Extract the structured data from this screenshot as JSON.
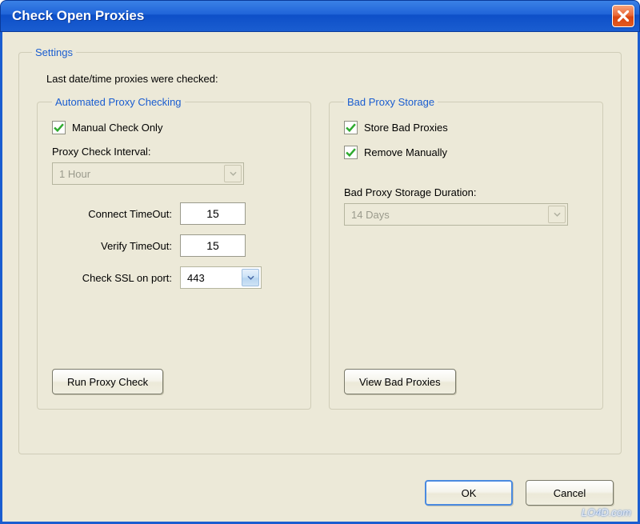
{
  "window": {
    "title": "Check Open Proxies"
  },
  "settings": {
    "legend": "Settings",
    "last_checked_label": "Last date/time proxies were checked:"
  },
  "auto": {
    "legend": "Automated Proxy Checking",
    "manual_check_only": "Manual Check Only",
    "interval_label": "Proxy Check Interval:",
    "interval_value": "1 Hour",
    "connect_timeout_label": "Connect TimeOut:",
    "connect_timeout_value": "15",
    "verify_timeout_label": "Verify TimeOut:",
    "verify_timeout_value": "15",
    "ssl_port_label": "Check SSL on port:",
    "ssl_port_value": "443",
    "run_check_btn": "Run Proxy Check"
  },
  "bad": {
    "legend": "Bad Proxy Storage",
    "store_bad": "Store Bad Proxies",
    "remove_manually": "Remove Manually",
    "duration_label": "Bad Proxy Storage Duration:",
    "duration_value": "14 Days",
    "view_btn": "View Bad Proxies"
  },
  "dialog": {
    "ok": "OK",
    "cancel": "Cancel"
  },
  "watermark": "LO4D.com"
}
